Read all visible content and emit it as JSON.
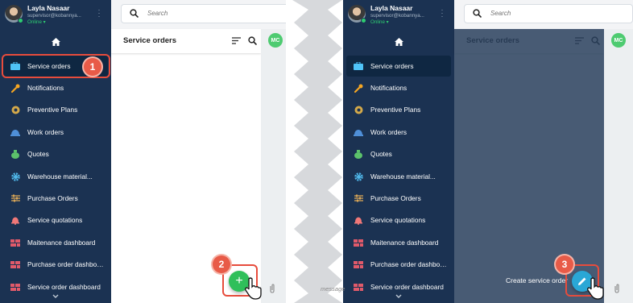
{
  "user": {
    "name": "Layla Nasaar",
    "email": "supervisor@kobannya...",
    "status": "Online"
  },
  "search": {
    "placeholder": "Search"
  },
  "list": {
    "title": "Service orders"
  },
  "chat": {
    "avatar_initials": "MC",
    "message_placeholder": "message"
  },
  "nav": {
    "items": [
      {
        "label": "Service orders",
        "icon": "briefcase-icon",
        "color": "#4fc3f7"
      },
      {
        "label": "Notifications",
        "icon": "wrench-icon",
        "color": "#f5a623"
      },
      {
        "label": "Preventive Plans",
        "icon": "gear-gold-icon",
        "color": "#d4a94a"
      },
      {
        "label": "Work orders",
        "icon": "hardhat-icon",
        "color": "#4f8fd8"
      },
      {
        "label": "Quotes",
        "icon": "moneybag-icon",
        "color": "#5cc26b"
      },
      {
        "label": "Warehouse material...",
        "icon": "cog-icon",
        "color": "#4fb6e8"
      },
      {
        "label": "Purchase Orders",
        "icon": "sliders-icon",
        "color": "#d9a657"
      },
      {
        "label": "Service quotations",
        "icon": "bell-icon",
        "color": "#f07878"
      },
      {
        "label": "Maitenance dashboard",
        "icon": "dashboard-icon",
        "color": "#e05a6a"
      },
      {
        "label": "Purchase order dashboa...",
        "icon": "dashboard-icon",
        "color": "#e05a6a"
      },
      {
        "label": "Service order dashboard",
        "icon": "dashboard-icon",
        "color": "#e05a6a"
      }
    ]
  },
  "steps": {
    "one": "1",
    "two": "2",
    "three": "3"
  },
  "fab": {
    "add_symbol": "+",
    "create_label": "Create service order"
  },
  "colors": {
    "sidebar": "#1b3252",
    "accent_green": "#2fbf5a",
    "edit_fab": "#2aa7d6",
    "highlight": "#e74c3c"
  }
}
